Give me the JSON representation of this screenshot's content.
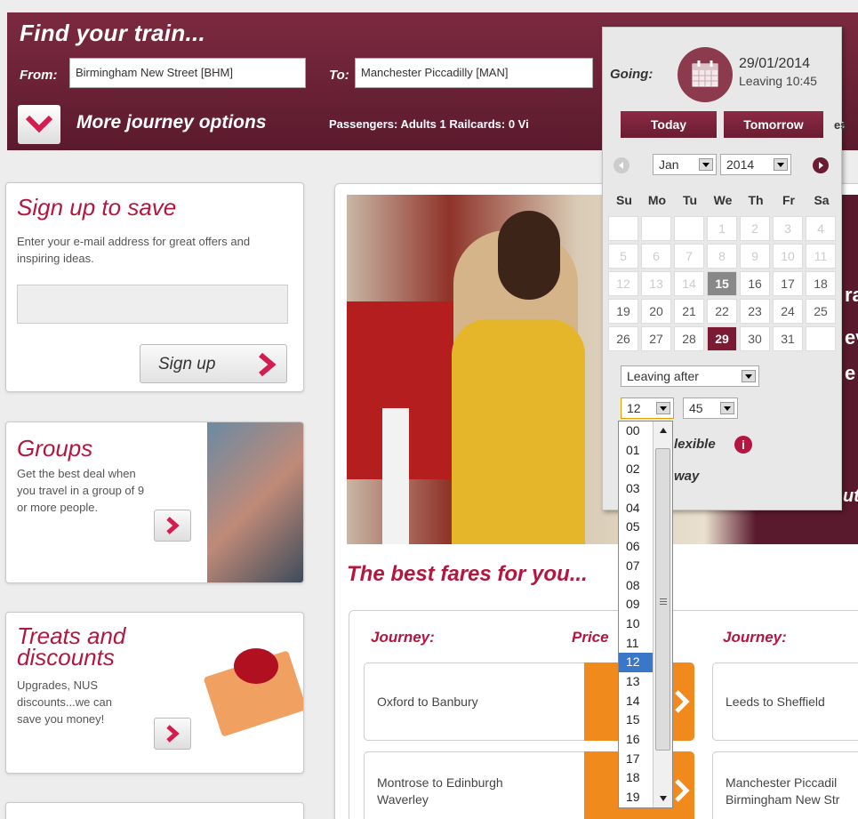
{
  "header": {
    "title": "Find your train...",
    "from_label": "From:",
    "from_value": "Birmingham New Street [BHM]",
    "to_label": "To:",
    "to_value": "Manchester Piccadilly [MAN]",
    "more_options_label": "More journey options",
    "passengers_text": "Passengers: Adults 1   Railcards: 0   Vi",
    "clip_text": "es"
  },
  "signup": {
    "title": "Sign up to save",
    "text": "Enter your e-mail address for great offers and inspiring ideas.",
    "email_value": "",
    "button_label": "Sign up"
  },
  "groups": {
    "title": "Groups",
    "text": "Get the best deal when you travel in a group of 9 or more people."
  },
  "treats": {
    "title": "Treats and discounts",
    "text": "Upgrades, NUS discounts...we can save you money!"
  },
  "hero": {
    "side_fragments": [
      "ra",
      "ev",
      "e",
      "ut"
    ]
  },
  "fares": {
    "title": "The best fares for you...",
    "journey_header": "Journey:",
    "price_header": "Price",
    "journey_header_2": "Journey:",
    "routes": [
      "Oxford to Banbury",
      "Montrose to Edinburgh Waverley",
      "Leeds to Sheffield",
      "Manchester Piccadil Birmingham New Str"
    ]
  },
  "calendar": {
    "going_label": "Going:",
    "date": "29/01/2014",
    "leaving": "Leaving 10:45",
    "today_label": "Today",
    "tomorrow_label": "Tomorrow",
    "tomorrow_clip": "es",
    "month": "Jan",
    "year": "2014",
    "weekdays": [
      "Su",
      "Mo",
      "Tu",
      "We",
      "Th",
      "Fr",
      "Sa"
    ],
    "weeks": [
      [
        "",
        "",
        "",
        "1",
        "2",
        "3",
        "4"
      ],
      [
        "5",
        "6",
        "7",
        "8",
        "9",
        "10",
        "11"
      ],
      [
        "12",
        "13",
        "14",
        "15",
        "16",
        "17",
        "18"
      ],
      [
        "19",
        "20",
        "21",
        "22",
        "23",
        "24",
        "25"
      ],
      [
        "26",
        "27",
        "28",
        "29",
        "30",
        "31",
        ""
      ]
    ],
    "leaving_after": "Leaving after",
    "hour": "12",
    "minute": "45",
    "flexible_text": "lexible",
    "way_text": "way"
  },
  "hour_options": [
    "00",
    "01",
    "02",
    "03",
    "04",
    "05",
    "06",
    "07",
    "08",
    "09",
    "10",
    "11",
    "12",
    "13",
    "14",
    "15",
    "16",
    "17",
    "18",
    "19"
  ],
  "selected_hour": "12",
  "colors": {
    "brand": "#6a2136",
    "accent": "#b5163f",
    "orange": "#f08a1c",
    "highlight": "#3b77c8"
  }
}
